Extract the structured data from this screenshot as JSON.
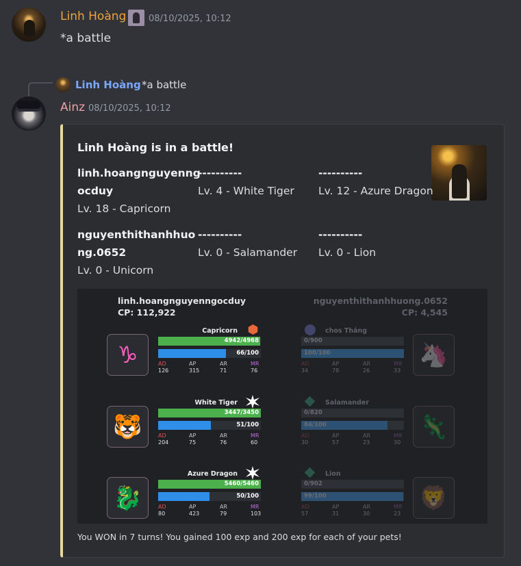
{
  "msg1": {
    "user": "Linh Hoàng",
    "time": "08/10/2025, 10:12",
    "text": "*a battle"
  },
  "reply": {
    "user": "Linh Hoàng",
    "text": "*a battle"
  },
  "msg2": {
    "user": "Ainz",
    "time": "08/10/2025, 10:12"
  },
  "colors": {
    "linh": "#f0a33a",
    "ainz": "#f0a0a8",
    "reply_user": "#7aa7ff",
    "embed_bar": "#e8d7a0"
  },
  "embed": {
    "title": "Linh Hoàng is in a battle!",
    "team1": {
      "name_l1": "linh.hoangnguyenng",
      "name_l2": "ocduy",
      "lv": "Lv. 18 - Capricorn",
      "pet1_dash": "----------",
      "pet1": "Lv. 4 - White Tiger",
      "pet2_dash": "----------",
      "pet2": "Lv. 12 - Azure Dragon"
    },
    "team2": {
      "name_l1": "nguyenthithanhhuo",
      "name_l2": "ng.0652",
      "lv": "Lv. 0 - Unicorn",
      "pet1_dash": "----------",
      "pet1": "Lv. 0 - Salamander",
      "pet2_dash": "----------",
      "pet2": "Lv. 0 - Lion"
    },
    "footer": "You WON in 7 turns! You gained 100 exp and 200 exp for each of your pets!"
  },
  "battle": {
    "p1": {
      "name": "linh.hoangnguyenngocduy",
      "cp": "CP: 112,922"
    },
    "p2": {
      "name": "nguyenthithanhhuong.0652",
      "cp": "CP: 4,545"
    },
    "stat_labels": {
      "ad": "AD",
      "ap": "AP",
      "ar": "AR",
      "mr": "MR"
    },
    "left": [
      {
        "name": "Capricorn",
        "hp": "4942/4968",
        "hp_frac": 0.995,
        "mp": "66/100",
        "mp_frac": 0.66,
        "ad": "126",
        "ap": "315",
        "ar": "71",
        "mr": "76",
        "icon": "capricorn-icon"
      },
      {
        "name": "White Tiger",
        "hp": "3447/3450",
        "hp_frac": 0.999,
        "mp": "51/100",
        "mp_frac": 0.51,
        "ad": "204",
        "ap": "75",
        "ar": "76",
        "mr": "60",
        "icon": "tiger-icon"
      },
      {
        "name": "Azure Dragon",
        "hp": "5460/5460",
        "hp_frac": 1.0,
        "mp": "50/100",
        "mp_frac": 0.5,
        "ad": "80",
        "ap": "423",
        "ar": "79",
        "mr": "103",
        "icon": "dragon-icon"
      }
    ],
    "right": [
      {
        "name": "chos Thắng",
        "hp": "0/900",
        "hp_frac": 0,
        "mp": "100/100",
        "mp_frac": 1.0,
        "ad": "34",
        "ap": "78",
        "ar": "26",
        "mr": "33",
        "icon": "unicorn-icon"
      },
      {
        "name": "Salamander",
        "hp": "0/820",
        "hp_frac": 0,
        "mp": "84/100",
        "mp_frac": 0.84,
        "ad": "30",
        "ap": "57",
        "ar": "23",
        "mr": "30",
        "icon": "salamander-icon"
      },
      {
        "name": "Lion",
        "hp": "0/902",
        "hp_frac": 0,
        "mp": "99/100",
        "mp_frac": 0.99,
        "ad": "57",
        "ap": "31",
        "ar": "30",
        "mr": "23",
        "icon": "lion-icon"
      }
    ]
  }
}
